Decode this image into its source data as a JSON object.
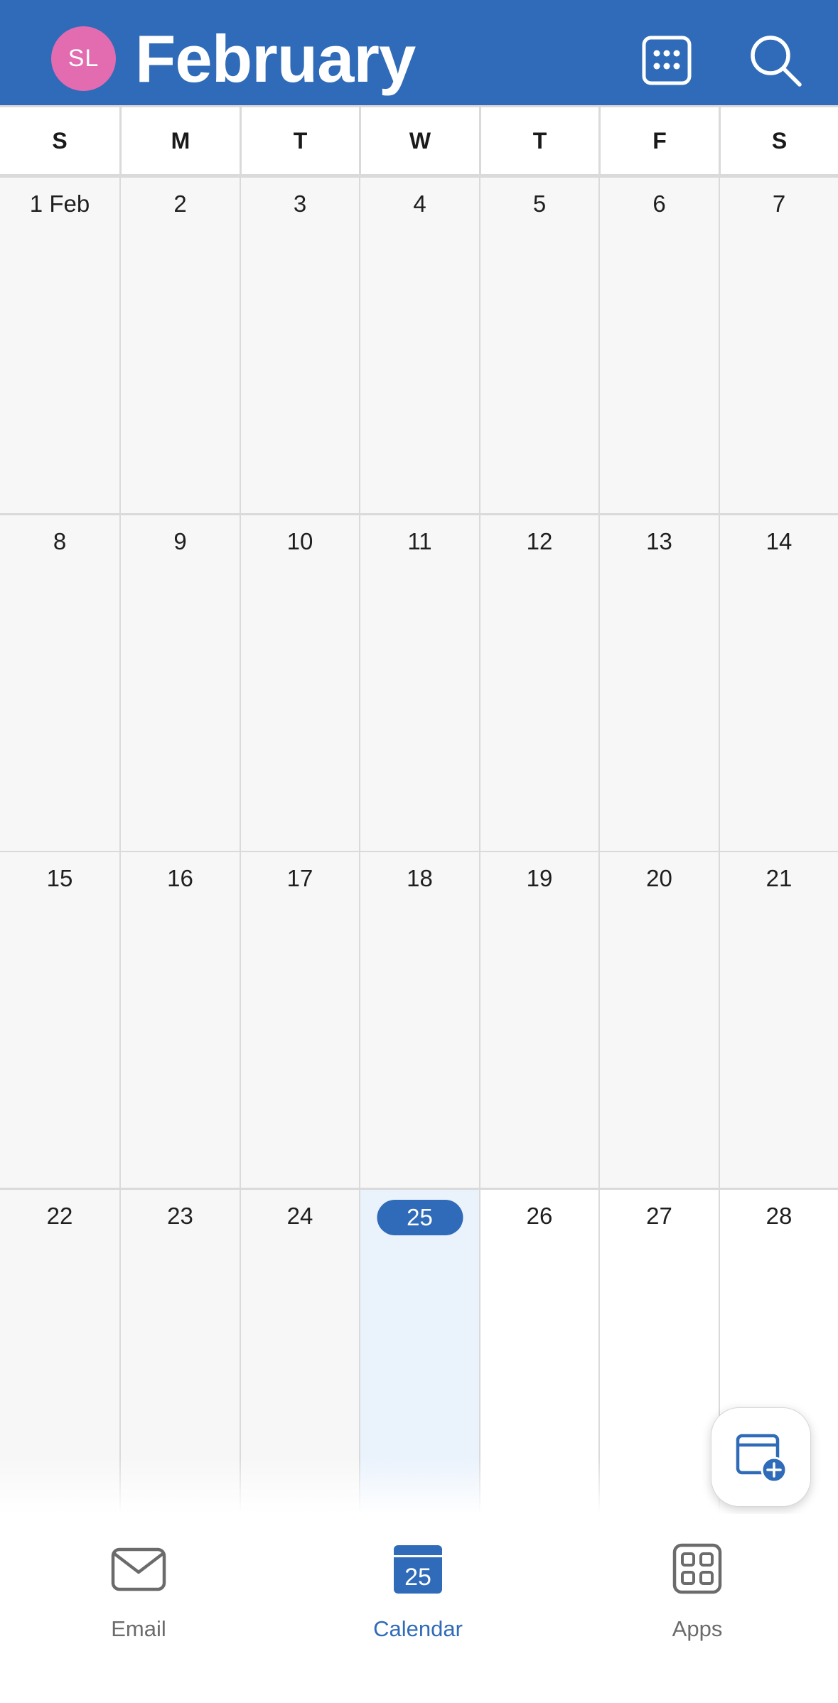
{
  "header": {
    "avatar_initials": "SL",
    "month": "February",
    "view_icon": "calendar-grid-icon",
    "search_icon": "search-icon",
    "accent": "#2f6bb8",
    "avatar_color": "#e36cb0"
  },
  "weekdays": [
    "S",
    "M",
    "T",
    "W",
    "T",
    "F",
    "S"
  ],
  "weeks": [
    [
      "1 Feb",
      "2",
      "3",
      "4",
      "5",
      "6",
      "7"
    ],
    [
      "8",
      "9",
      "10",
      "11",
      "12",
      "13",
      "14"
    ],
    [
      "15",
      "16",
      "17",
      "18",
      "19",
      "20",
      "21"
    ],
    [
      "22",
      "23",
      "24",
      "25",
      "26",
      "27",
      "28"
    ]
  ],
  "today": "25",
  "fab": {
    "icon": "add-event-icon"
  },
  "bottom_nav": {
    "items": [
      {
        "label": "Email",
        "icon": "mail-icon",
        "active": false
      },
      {
        "label": "Calendar",
        "icon": "calendar-icon",
        "badge": "25",
        "active": true
      },
      {
        "label": "Apps",
        "icon": "apps-grid-icon",
        "active": false
      }
    ]
  }
}
